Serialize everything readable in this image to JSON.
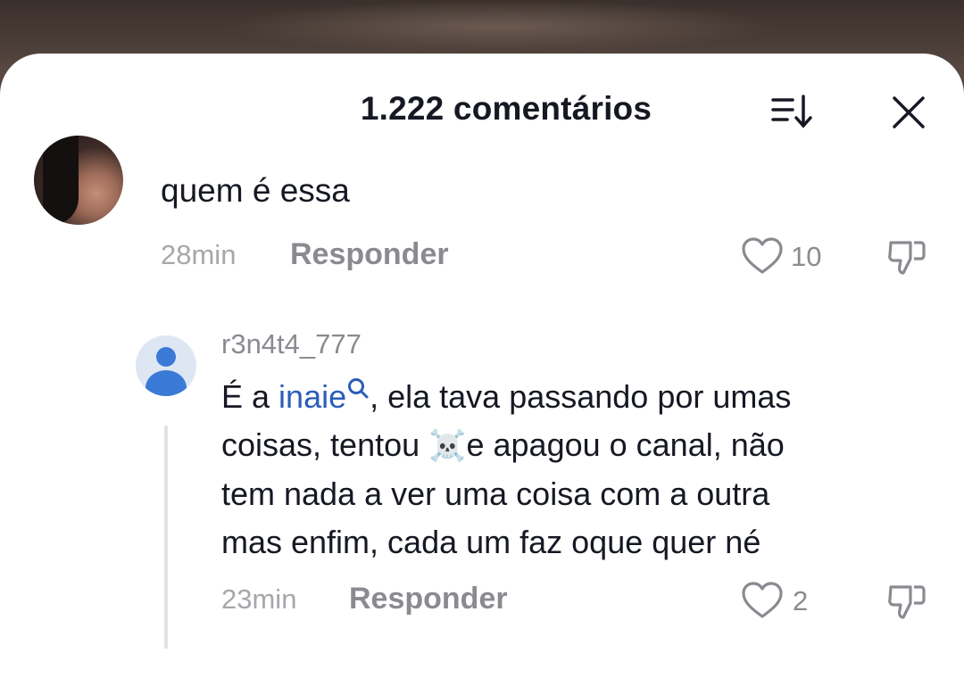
{
  "header": {
    "title": "1.222 comentários",
    "sort_icon": "sort-icon",
    "close_icon": "close-icon"
  },
  "comments": [
    {
      "text": "quem é essa",
      "time": "28min",
      "reply_label": "Responder",
      "likes": "10"
    }
  ],
  "reply": {
    "username": "r3n4t4_777",
    "text_prefix": "É a ",
    "mention": "inaie",
    "text_line1_rest": ", ela tava passando por umas",
    "text_line2_a": "coisas, tentou ",
    "emoji": "☠️",
    "text_line2_b": "e apagou o canal, não",
    "text_line3": "tem nada a ver uma coisa com a outra",
    "text_line4": "mas enfim, cada um faz oque quer né",
    "time": "23min",
    "reply_label": "Responder",
    "likes": "2"
  },
  "colors": {
    "mention": "#2b5db9",
    "text": "#161823",
    "muted": "#8a8b91"
  }
}
